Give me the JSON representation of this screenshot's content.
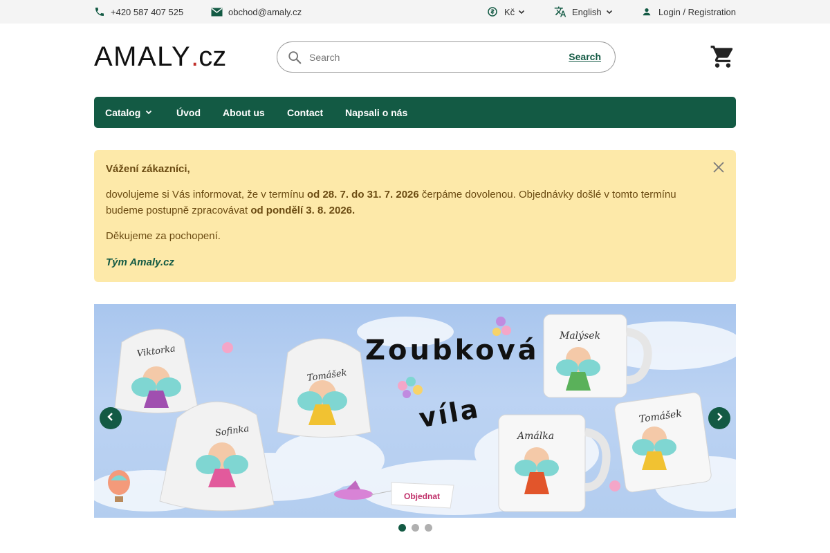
{
  "topbar": {
    "phone": "+420 587 407 525",
    "email": "obchod@amaly.cz",
    "currency": "Kč",
    "language": "English",
    "login": "Login / Registration"
  },
  "header": {
    "logo_brand": "AMALY",
    "logo_dot": ".",
    "logo_tld": "cz",
    "search_placeholder": "Search",
    "search_button": "Search"
  },
  "nav": {
    "items": [
      {
        "label": "Catalog"
      },
      {
        "label": "Úvod"
      },
      {
        "label": "About us"
      },
      {
        "label": "Contact"
      },
      {
        "label": "Napsali o nás"
      }
    ]
  },
  "notice": {
    "greeting": "Vážení zákazníci,",
    "text_a": "dovolujeme si Vás informovat, že v termínu ",
    "text_b": "od 28. 7. do 31. 7. 2026",
    "text_c": " čerpáme dovolenou. Objednávky došlé v tomto termínu",
    "text_d": "budeme postupně zpracovávat ",
    "text_e": "od pondělí 3. 8. 2026.",
    "thanks": "Děkujeme za pochopení.",
    "signature": "Tým Amaly.cz"
  },
  "banner": {
    "title_top": "Zoubková",
    "title_bottom": "víla",
    "names": [
      "Viktorka",
      "Tomášek",
      "Sofinka",
      "Malýsek",
      "Amálka",
      "Tomášek"
    ],
    "order_label": "Objednat",
    "slide_count": 3,
    "active_slide": 0
  },
  "colors": {
    "brand_green": "#135a44",
    "notice_bg": "#fde9a9",
    "notice_text": "#6b4b12",
    "logo_dot": "#c0302a"
  }
}
